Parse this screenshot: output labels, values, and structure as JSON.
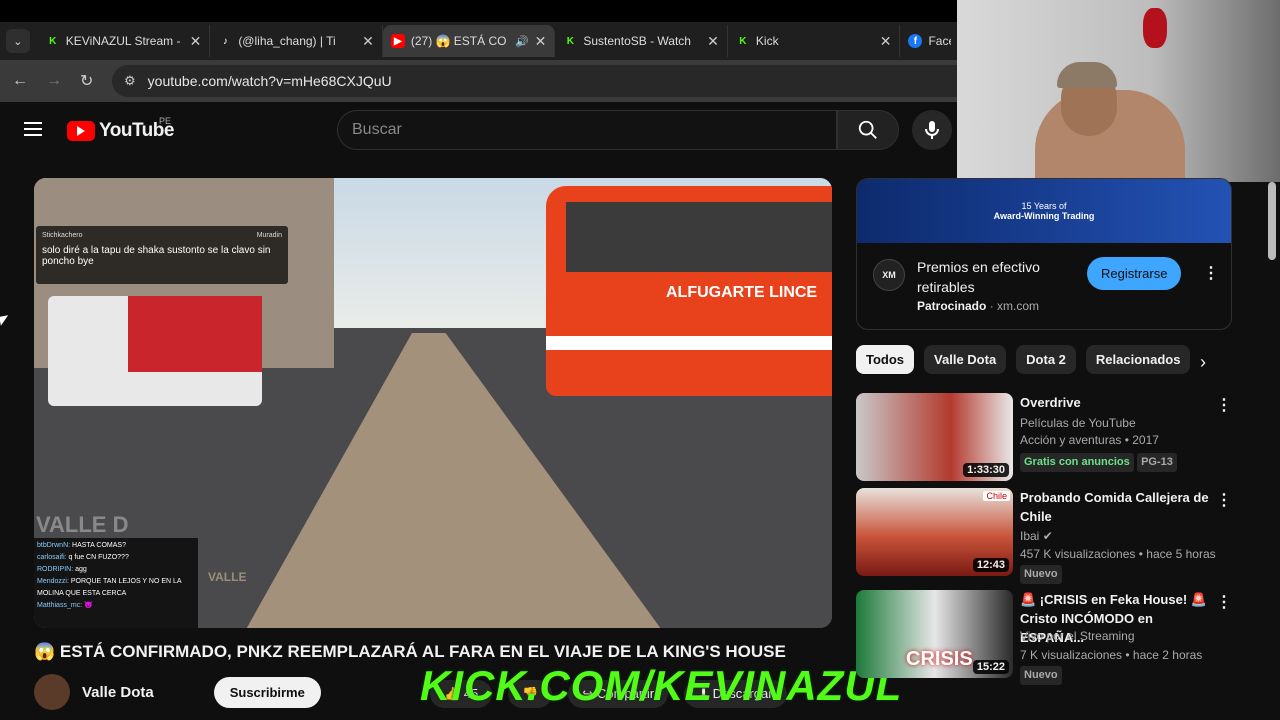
{
  "browser": {
    "tabs": [
      {
        "label": "KEViNAZUL Stream -",
        "icon": "kick-icon",
        "color": "#53fc18"
      },
      {
        "label": "(@liha_chang) | Ti",
        "icon": "tiktok-icon",
        "color": "#ffffff"
      },
      {
        "label": "(27) 😱 ESTÁ CO",
        "icon": "youtube-icon",
        "color": "#ff0000"
      },
      {
        "label": "SustentoSB - Watch",
        "icon": "kick-icon",
        "color": "#53fc18"
      },
      {
        "label": "Kick",
        "icon": "kick-icon",
        "color": "#53fc18"
      },
      {
        "label": "Faceb",
        "icon": "facebook-icon",
        "color": "#1877f2"
      }
    ],
    "url": "youtube.com/watch?v=mHe68CXJQuU"
  },
  "youtube": {
    "logo_text": "YouTube",
    "region": "PE",
    "search_placeholder": "Buscar"
  },
  "video": {
    "chat_highlight_user": "Stichkachero",
    "chat_highlight_mod": "Muradin",
    "chat_highlight_text": "solo diré a la tapu de shaka sustonto se la clavo sin poncho bye",
    "chat_lines": [
      {
        "user": "btbDrwnN:",
        "text": "HASTA COMAS?"
      },
      {
        "user": "carlosaifi:",
        "text": "q fue CN FUZO???"
      },
      {
        "user": "RODRIPIN:",
        "text": "agg"
      },
      {
        "user": "Mendozzi:",
        "text": "PORQUE TAN LEJOS Y NO EN LA MOLINA QUE ESTA CERCA"
      },
      {
        "user": "Matthiass_mc:",
        "text": "😈"
      }
    ],
    "watermark": "VALLE D",
    "channel_badge": "VALLE",
    "bus_label": "ALFUGARTE  LINCE",
    "title": "😱 ESTÁ CONFIRMADO, PNKZ REEMPLAZARÁ AL FARA EN EL VIAJE DE LA KING'S HOUSE",
    "channel": "Valle Dota",
    "subscribe": "Suscribirme",
    "likes": "45",
    "share": "Compartir",
    "download": "Descargar"
  },
  "overlay": {
    "kick_text": "KICK.COM/KEVINAZUL"
  },
  "ad": {
    "banner_line1": "15 Years of",
    "banner_line2": "Award-Winning Trading",
    "logo": "XM",
    "title": "Premios en efectivo retirables",
    "sponsored": "Patrocinado",
    "domain": "xm.com",
    "cta": "Registrarse"
  },
  "chips": [
    "Todos",
    "Valle Dota",
    "Dota 2",
    "Relacionados"
  ],
  "recommendations": [
    {
      "title": "Overdrive",
      "channel": "Películas de YouTube",
      "meta": "Acción y aventuras • 2017",
      "badge1": "Gratis con anuncios",
      "badge2": "PG-13",
      "duration": "1:33:30",
      "thumb_color": "#b33a2e"
    },
    {
      "title": "Probando Comida Callejera de Chile",
      "channel": "Ibai",
      "meta": "457 K visualizaciones • hace 5 horas",
      "badge1": "Nuevo",
      "duration": "12:43",
      "thumb_color": "#c9543a",
      "tag": "Chile"
    },
    {
      "title": "🚨 ¡CRISIS en Feka House! 🚨 Cristo INCÓMODO en ESPAÑA...",
      "channel": "Vivo por el Streaming",
      "meta": "7 K visualizaciones • hace 2 horas",
      "badge1": "Nuevo",
      "duration": "15:22",
      "thumb_color": "#1c7a3a",
      "thumb_text": "CRISIS"
    }
  ]
}
